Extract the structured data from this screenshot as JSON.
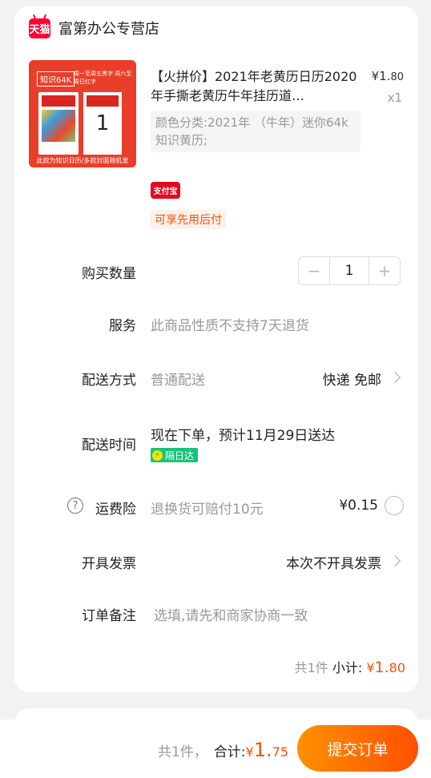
{
  "shop": {
    "badge": "天猫",
    "name": "富第办公专营店"
  },
  "product": {
    "title": "【火拼价】2021年老黄历日历2020年手撕老黄历牛年挂历道…",
    "price_symbol": "¥",
    "price_int": "1.",
    "price_dec": "80",
    "qty": "x1",
    "sku": "颜色分类:2021年 （牛年）迷你64k 知识黄历;",
    "thumb": {
      "tag": "知识64K",
      "tagline": "周一至周五黑字 周六至周日红字",
      "big_num": "1",
      "footer": "此款为知识日历/多款封面随机发"
    },
    "promo_badge": "支付宝",
    "pay_later": "可享先用后付"
  },
  "rows": {
    "quantity": {
      "label": "购买数量",
      "value": "1",
      "minus": "−",
      "plus": "+"
    },
    "service": {
      "label": "服务",
      "value": "此商品性质不支持7天退货"
    },
    "delivery": {
      "label": "配送方式",
      "value": "普通配送",
      "right": "快递 免邮"
    },
    "delivery_time": {
      "label": "配送时间",
      "value": "现在下单，预计11月29日送达",
      "badge": "隔日达"
    },
    "insurance": {
      "label": "运费险",
      "value": "退换货可赔付10元",
      "price": "¥0.15"
    },
    "invoice": {
      "label": "开具发票",
      "right": "本次不开具发票"
    },
    "note": {
      "label": "订单备注",
      "placeholder": "选填,请先和商家协商一致"
    }
  },
  "subtotal": {
    "count": "共1件",
    "label": "小计:",
    "symbol": "¥",
    "int": "1.",
    "dec": "80"
  },
  "bottom": {
    "count": "共1件，",
    "label": "合计:",
    "symbol": "¥",
    "int": "1.",
    "dec": "75",
    "submit": "提交订单"
  },
  "colors": {
    "accent": "#ff5000",
    "tmall": "#ff0036",
    "green": "#17c37b"
  }
}
